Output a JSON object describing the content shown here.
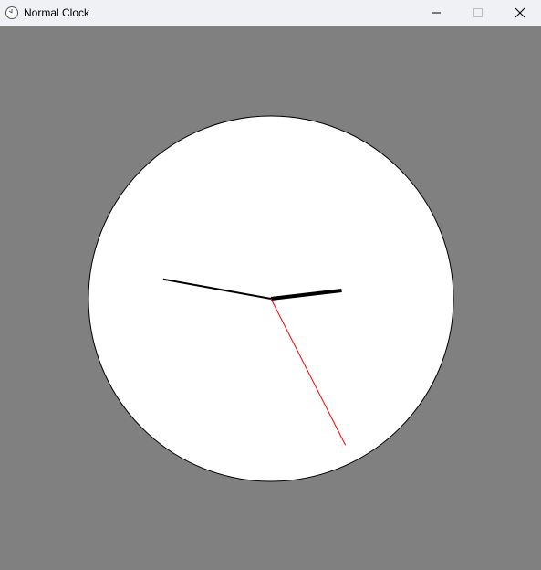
{
  "window": {
    "title": "Normal Clock",
    "app_icon": "clock-icon",
    "controls": {
      "minimize_icon": "minimize-icon",
      "maximize_icon": "maximize-icon",
      "close_icon": "close-icon"
    }
  },
  "colors": {
    "titlebar_bg": "#f0f1f4",
    "client_bg": "#808080",
    "clock_face": "#ffffff",
    "clock_outline": "#000000",
    "hour_hand": "#000000",
    "minute_hand": "#000000",
    "second_hand": "#ff0000"
  },
  "clock": {
    "time": {
      "hours": 2,
      "minutes": 46.7,
      "seconds": 25.5
    }
  }
}
